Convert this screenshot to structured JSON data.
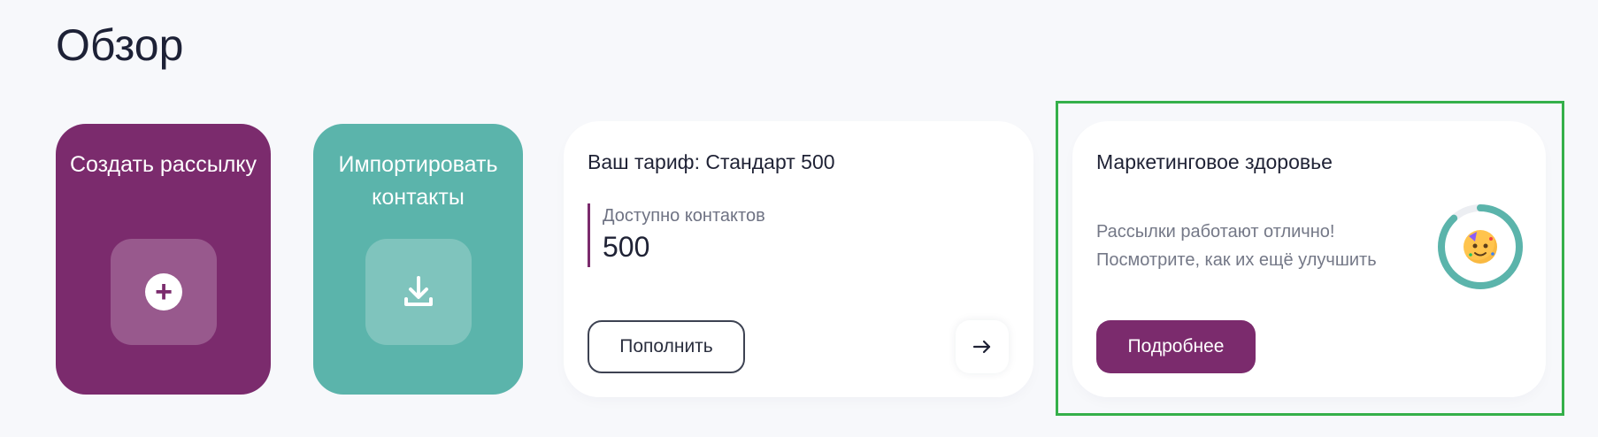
{
  "page": {
    "title": "Обзор"
  },
  "actions": {
    "create": {
      "label": "Создать рассылку",
      "icon": "plus-circle-icon",
      "color": "#7b2b6d"
    },
    "import": {
      "label": "Импортировать контакты",
      "icon": "download-icon",
      "color": "#5bb4ab"
    }
  },
  "tariff": {
    "title": "Ваш тариф: Стандарт 500",
    "contacts_label": "Доступно контактов",
    "contacts_value": "500",
    "topup_label": "Пополнить",
    "arrow_icon": "arrow-right-icon"
  },
  "marketing_health": {
    "title": "Маркетинговое здоровье",
    "message_line1": "Рассылки работают отлично!",
    "message_line2": "Посмотрите, как их ещё улучшить",
    "score_fraction": 0.88,
    "ring_color": "#5bb4ab",
    "emoji_icon": "party-face-icon",
    "details_label": "Подробнее"
  }
}
